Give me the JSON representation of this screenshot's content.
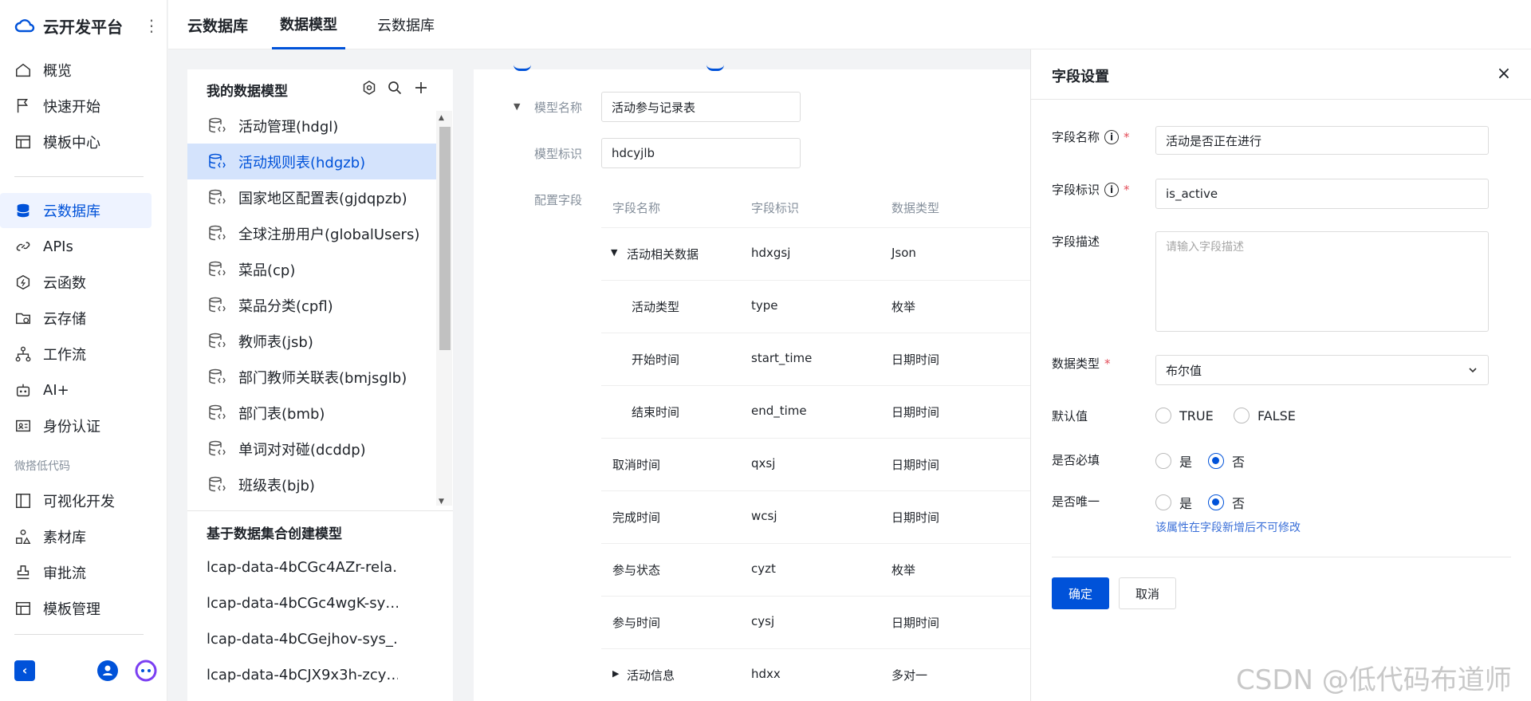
{
  "app": {
    "title": "云开发平台"
  },
  "sidebar": {
    "items": [
      {
        "label": "概览",
        "icon": "home-icon"
      },
      {
        "label": "快速开始",
        "icon": "flag-icon"
      },
      {
        "label": "模板中心",
        "icon": "template-icon"
      },
      {
        "label": "云数据库",
        "icon": "database-icon",
        "active": true
      },
      {
        "label": "APIs",
        "icon": "link-icon"
      },
      {
        "label": "云函数",
        "icon": "function-icon"
      },
      {
        "label": "云存储",
        "icon": "folder-icon"
      },
      {
        "label": "工作流",
        "icon": "workflow-icon"
      },
      {
        "label": "AI+",
        "icon": "robot-icon"
      },
      {
        "label": "身份认证",
        "icon": "id-card-icon"
      }
    ],
    "group_label": "微搭低代码",
    "lowcode_items": [
      {
        "label": "可视化开发",
        "icon": "layout-icon"
      },
      {
        "label": "素材库",
        "icon": "shapes-icon"
      },
      {
        "label": "审批流",
        "icon": "stamp-icon"
      },
      {
        "label": "模板管理",
        "icon": "template-icon"
      }
    ]
  },
  "topbar": {
    "title": "云数据库",
    "tabs": [
      {
        "label": "数据模型",
        "active": true
      },
      {
        "label": "云数据库",
        "active": false
      }
    ]
  },
  "models_panel": {
    "title": "我的数据模型",
    "models": [
      {
        "label": "活动管理(hdgl)"
      },
      {
        "label": "活动规则表(hdgzb)",
        "active": true
      },
      {
        "label": "国家地区配置表(gjdqpzb)"
      },
      {
        "label": "全球注册用户(globalUsers)"
      },
      {
        "label": "菜品(cp)"
      },
      {
        "label": "菜品分类(cpfl)"
      },
      {
        "label": "教师表(jsb)"
      },
      {
        "label": "部门教师关联表(bmjsglb)"
      },
      {
        "label": "部门表(bmb)"
      },
      {
        "label": "单词对对碰(dcddp)"
      },
      {
        "label": "班级表(bjb)"
      }
    ],
    "datasource_title": "基于数据集合创建模型",
    "datasources": [
      "lcap-data-4bCGc4AZr-rela…",
      "lcap-data-4bCGc4wgK-sy…",
      "lcap-data-4bCGejhov-sys_…",
      "lcap-data-4bCJX9x3h-zcy…"
    ]
  },
  "model_detail": {
    "name_label": "模型名称",
    "name_value": "活动参与记录表",
    "id_label": "模型标识",
    "id_value": "hdcyjlb",
    "fields_label": "配置字段",
    "columns": [
      "字段名称",
      "字段标识",
      "数据类型"
    ],
    "fields": [
      {
        "name": "活动相关数据",
        "key": "hdxgsj",
        "type": "Json",
        "expand": "down",
        "level": 0
      },
      {
        "name": "活动类型",
        "key": "type",
        "type": "枚举",
        "level": 1
      },
      {
        "name": "开始时间",
        "key": "start_time",
        "type": "日期时间",
        "level": 1
      },
      {
        "name": "结束时间",
        "key": "end_time",
        "type": "日期时间",
        "level": 1
      },
      {
        "name": "取消时间",
        "key": "qxsj",
        "type": "日期时间",
        "level": 0
      },
      {
        "name": "完成时间",
        "key": "wcsj",
        "type": "日期时间",
        "level": 0
      },
      {
        "name": "参与状态",
        "key": "cyzt",
        "type": "枚举",
        "level": 0
      },
      {
        "name": "参与时间",
        "key": "cysj",
        "type": "日期时间",
        "level": 0
      },
      {
        "name": "活动信息",
        "key": "hdxx",
        "type": "多对一",
        "expand": "right",
        "level": 0
      }
    ]
  },
  "drawer": {
    "title": "字段设置",
    "close": "×",
    "field_name_label": "字段名称",
    "field_name_value": "活动是否正在进行",
    "field_key_label": "字段标识",
    "field_key_value": "is_active",
    "desc_label": "字段描述",
    "desc_placeholder": "请输入字段描述",
    "type_label": "数据类型",
    "type_value": "布尔值",
    "default_label": "默认值",
    "default_true": "TRUE",
    "default_false": "FALSE",
    "required_label": "是否必填",
    "unique_label": "是否唯一",
    "yes": "是",
    "no": "否",
    "unique_hint": "该属性在字段新增后不可修改",
    "confirm": "确定",
    "cancel": "取消",
    "required_mark": "*",
    "info_mark": "i"
  },
  "watermark": "CSDN @低代码布道师",
  "colors": {
    "accent": "#0052d9",
    "active_bg": "#d4e3fc",
    "required": "#e34d59"
  }
}
